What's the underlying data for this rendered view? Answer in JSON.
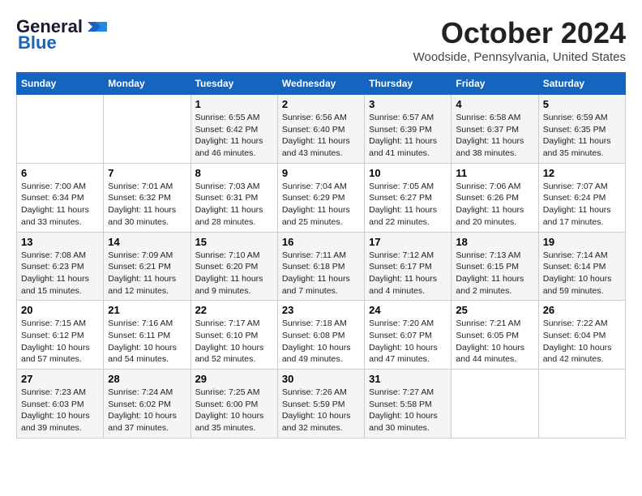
{
  "header": {
    "logo_line1": "General",
    "logo_line2": "Blue",
    "month_title": "October 2024",
    "location": "Woodside, Pennsylvania, United States"
  },
  "weekdays": [
    "Sunday",
    "Monday",
    "Tuesday",
    "Wednesday",
    "Thursday",
    "Friday",
    "Saturday"
  ],
  "weeks": [
    [
      {
        "day": "",
        "info": ""
      },
      {
        "day": "",
        "info": ""
      },
      {
        "day": "1",
        "info": "Sunrise: 6:55 AM\nSunset: 6:42 PM\nDaylight: 11 hours and 46 minutes."
      },
      {
        "day": "2",
        "info": "Sunrise: 6:56 AM\nSunset: 6:40 PM\nDaylight: 11 hours and 43 minutes."
      },
      {
        "day": "3",
        "info": "Sunrise: 6:57 AM\nSunset: 6:39 PM\nDaylight: 11 hours and 41 minutes."
      },
      {
        "day": "4",
        "info": "Sunrise: 6:58 AM\nSunset: 6:37 PM\nDaylight: 11 hours and 38 minutes."
      },
      {
        "day": "5",
        "info": "Sunrise: 6:59 AM\nSunset: 6:35 PM\nDaylight: 11 hours and 35 minutes."
      }
    ],
    [
      {
        "day": "6",
        "info": "Sunrise: 7:00 AM\nSunset: 6:34 PM\nDaylight: 11 hours and 33 minutes."
      },
      {
        "day": "7",
        "info": "Sunrise: 7:01 AM\nSunset: 6:32 PM\nDaylight: 11 hours and 30 minutes."
      },
      {
        "day": "8",
        "info": "Sunrise: 7:03 AM\nSunset: 6:31 PM\nDaylight: 11 hours and 28 minutes."
      },
      {
        "day": "9",
        "info": "Sunrise: 7:04 AM\nSunset: 6:29 PM\nDaylight: 11 hours and 25 minutes."
      },
      {
        "day": "10",
        "info": "Sunrise: 7:05 AM\nSunset: 6:27 PM\nDaylight: 11 hours and 22 minutes."
      },
      {
        "day": "11",
        "info": "Sunrise: 7:06 AM\nSunset: 6:26 PM\nDaylight: 11 hours and 20 minutes."
      },
      {
        "day": "12",
        "info": "Sunrise: 7:07 AM\nSunset: 6:24 PM\nDaylight: 11 hours and 17 minutes."
      }
    ],
    [
      {
        "day": "13",
        "info": "Sunrise: 7:08 AM\nSunset: 6:23 PM\nDaylight: 11 hours and 15 minutes."
      },
      {
        "day": "14",
        "info": "Sunrise: 7:09 AM\nSunset: 6:21 PM\nDaylight: 11 hours and 12 minutes."
      },
      {
        "day": "15",
        "info": "Sunrise: 7:10 AM\nSunset: 6:20 PM\nDaylight: 11 hours and 9 minutes."
      },
      {
        "day": "16",
        "info": "Sunrise: 7:11 AM\nSunset: 6:18 PM\nDaylight: 11 hours and 7 minutes."
      },
      {
        "day": "17",
        "info": "Sunrise: 7:12 AM\nSunset: 6:17 PM\nDaylight: 11 hours and 4 minutes."
      },
      {
        "day": "18",
        "info": "Sunrise: 7:13 AM\nSunset: 6:15 PM\nDaylight: 11 hours and 2 minutes."
      },
      {
        "day": "19",
        "info": "Sunrise: 7:14 AM\nSunset: 6:14 PM\nDaylight: 10 hours and 59 minutes."
      }
    ],
    [
      {
        "day": "20",
        "info": "Sunrise: 7:15 AM\nSunset: 6:12 PM\nDaylight: 10 hours and 57 minutes."
      },
      {
        "day": "21",
        "info": "Sunrise: 7:16 AM\nSunset: 6:11 PM\nDaylight: 10 hours and 54 minutes."
      },
      {
        "day": "22",
        "info": "Sunrise: 7:17 AM\nSunset: 6:10 PM\nDaylight: 10 hours and 52 minutes."
      },
      {
        "day": "23",
        "info": "Sunrise: 7:18 AM\nSunset: 6:08 PM\nDaylight: 10 hours and 49 minutes."
      },
      {
        "day": "24",
        "info": "Sunrise: 7:20 AM\nSunset: 6:07 PM\nDaylight: 10 hours and 47 minutes."
      },
      {
        "day": "25",
        "info": "Sunrise: 7:21 AM\nSunset: 6:05 PM\nDaylight: 10 hours and 44 minutes."
      },
      {
        "day": "26",
        "info": "Sunrise: 7:22 AM\nSunset: 6:04 PM\nDaylight: 10 hours and 42 minutes."
      }
    ],
    [
      {
        "day": "27",
        "info": "Sunrise: 7:23 AM\nSunset: 6:03 PM\nDaylight: 10 hours and 39 minutes."
      },
      {
        "day": "28",
        "info": "Sunrise: 7:24 AM\nSunset: 6:02 PM\nDaylight: 10 hours and 37 minutes."
      },
      {
        "day": "29",
        "info": "Sunrise: 7:25 AM\nSunset: 6:00 PM\nDaylight: 10 hours and 35 minutes."
      },
      {
        "day": "30",
        "info": "Sunrise: 7:26 AM\nSunset: 5:59 PM\nDaylight: 10 hours and 32 minutes."
      },
      {
        "day": "31",
        "info": "Sunrise: 7:27 AM\nSunset: 5:58 PM\nDaylight: 10 hours and 30 minutes."
      },
      {
        "day": "",
        "info": ""
      },
      {
        "day": "",
        "info": ""
      }
    ]
  ]
}
